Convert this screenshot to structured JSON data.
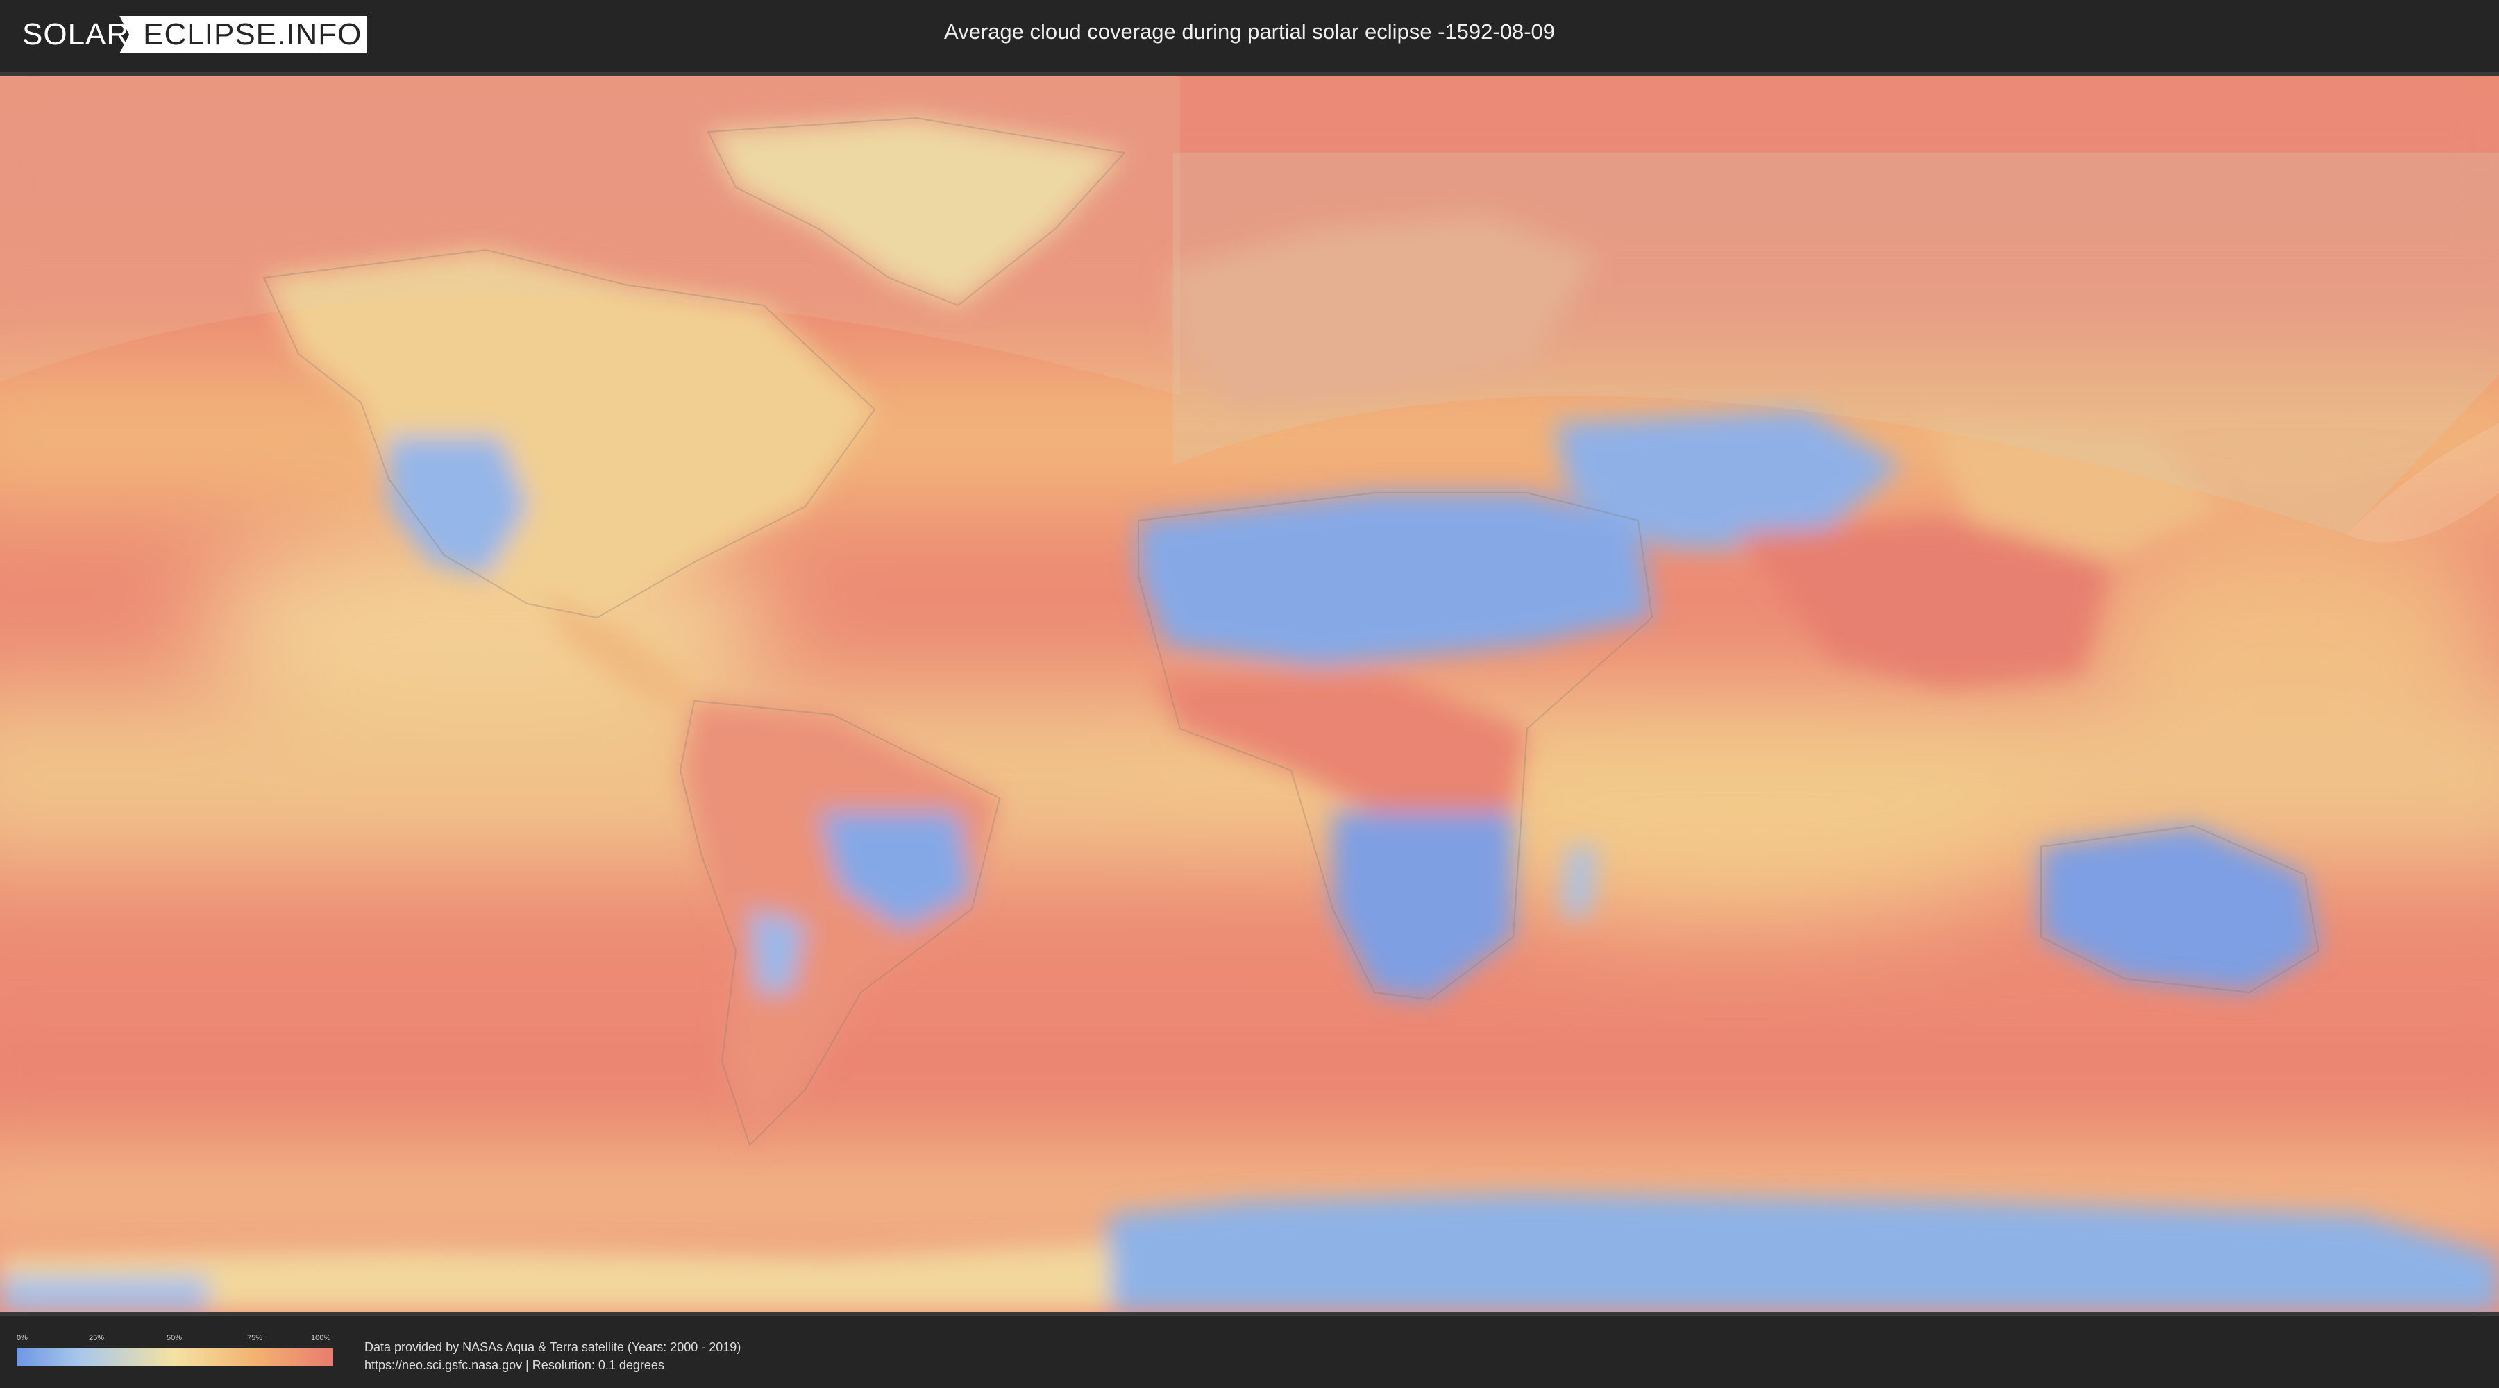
{
  "header": {
    "logo_left": "SOLAR",
    "logo_right": "ECLIPSE.INFO",
    "title": "Average cloud coverage during partial solar eclipse -1592-08-09"
  },
  "legend": {
    "labels": [
      "0%",
      "25%",
      "50%",
      "75%",
      "100%"
    ],
    "colors": [
      "#6f97e5",
      "#a9c7ea",
      "#f4e2a2",
      "#f3b36f",
      "#e97b6f"
    ]
  },
  "credits": {
    "line1": "Data provided by NASAs Aqua & Terra satellite (Years: 2000 - 2019)",
    "line2": "https://neo.sci.gsfc.nasa.gov | Resolution: 0.1 degrees"
  }
}
